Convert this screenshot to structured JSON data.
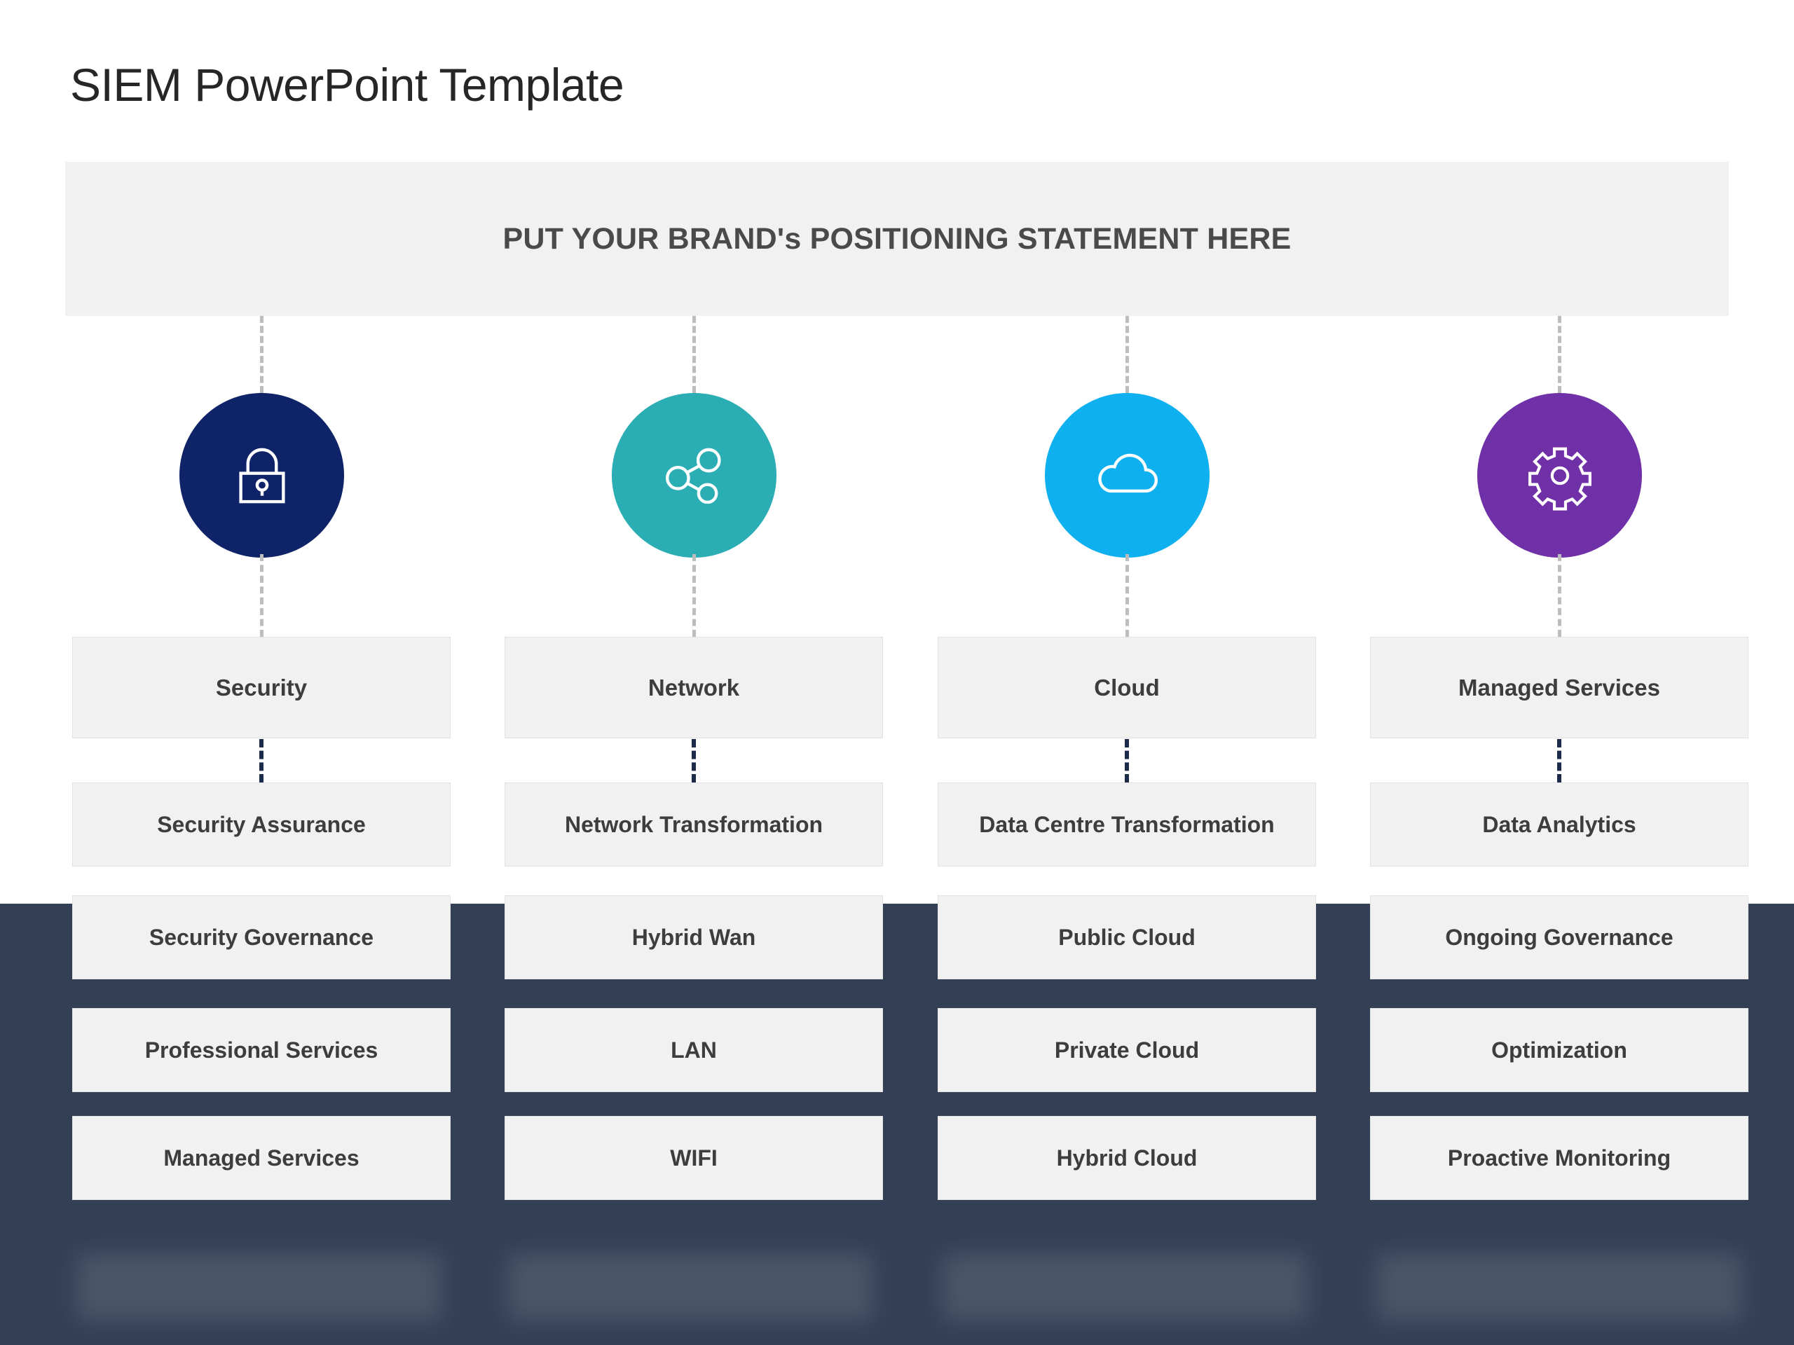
{
  "slide": {
    "title": "SIEM PowerPoint Template",
    "banner_text": "PUT YOUR BRAND's POSITIONING STATEMENT HERE",
    "background_color": "#ffffff",
    "band_color": "#333f55",
    "box_color": "#f1f1f1",
    "text_color": "#3d3d3d"
  },
  "columns": [
    {
      "icon": "lock-icon",
      "icon_color": "#0f2468",
      "header": "Security",
      "items": [
        "Security Assurance",
        "Security Governance",
        "Professional Services",
        "Managed Services"
      ]
    },
    {
      "icon": "share-network-icon",
      "icon_color": "#2aadb3",
      "header": "Network",
      "items": [
        "Network Transformation",
        "Hybrid Wan",
        "LAN",
        "WIFI"
      ]
    },
    {
      "icon": "cloud-icon",
      "icon_color": "#0fb0ef",
      "header": "Cloud",
      "items": [
        "Data Centre Transformation",
        "Public Cloud",
        "Private Cloud",
        "Hybrid Cloud"
      ]
    },
    {
      "icon": "gear-icon",
      "icon_color": "#7030a7",
      "header": "Managed Services",
      "items": [
        "Data Analytics",
        "Ongoing Governance",
        "Optimization",
        "Proactive Monitoring"
      ]
    }
  ]
}
